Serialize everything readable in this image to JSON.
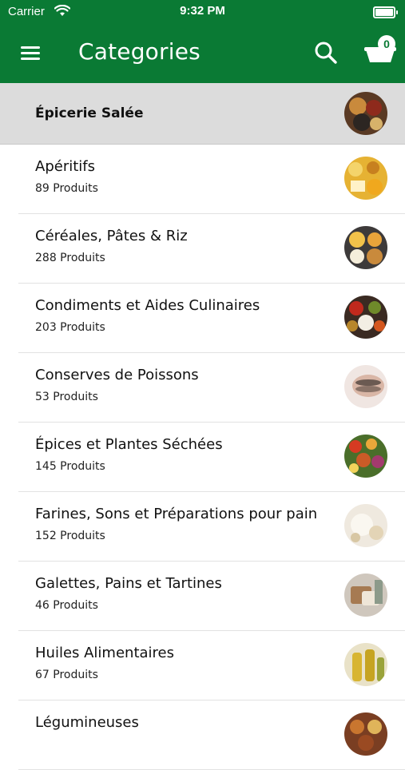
{
  "status_bar": {
    "carrier": "Carrier",
    "time": "9:32 PM"
  },
  "nav": {
    "title": "Categories",
    "cart_count": "0"
  },
  "section": {
    "title": "Épicerie Salée",
    "thumb_icon": "spices-bowls-image"
  },
  "categories": [
    {
      "name": "Apéritifs",
      "count": "89 Produits",
      "thumb_icon": "snacks-image"
    },
    {
      "name": "Céréales, Pâtes & Riz",
      "count": "288 Produits",
      "thumb_icon": "cereal-bowls-image"
    },
    {
      "name": "Condiments et Aides Culinaires",
      "count": "203 Produits",
      "thumb_icon": "condiments-image"
    },
    {
      "name": "Conserves de Poissons",
      "count": "53 Produits",
      "thumb_icon": "canned-fish-image"
    },
    {
      "name": "Épices et Plantes Séchées",
      "count": "145 Produits",
      "thumb_icon": "spices-image"
    },
    {
      "name": "Farines, Sons et Préparations pour pain",
      "count": "152 Produits",
      "thumb_icon": "flour-image"
    },
    {
      "name": "Galettes, Pains et Tartines",
      "count": "46 Produits",
      "thumb_icon": "bread-image"
    },
    {
      "name": "Huiles Alimentaires",
      "count": "67 Produits",
      "thumb_icon": "oil-bottles-image"
    },
    {
      "name": "Légumineuses",
      "count": "",
      "thumb_icon": "legumes-image"
    }
  ],
  "colors": {
    "brand_green": "#0a7a34",
    "section_bg": "#dcdcdc"
  }
}
